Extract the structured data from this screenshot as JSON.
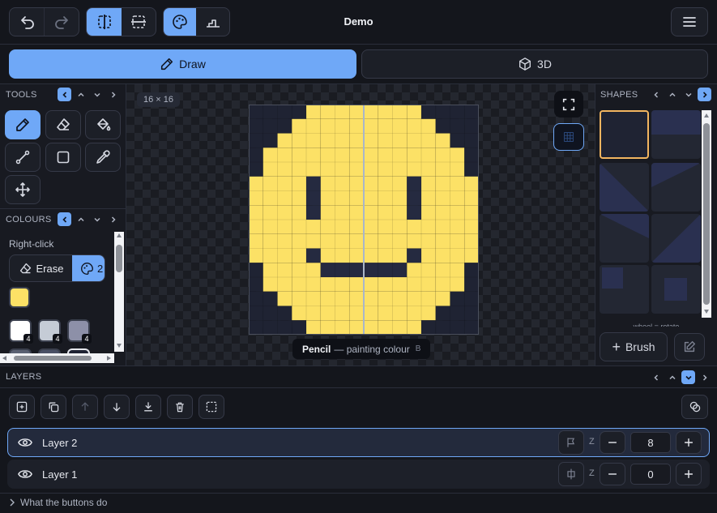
{
  "app": {
    "title": "Demo"
  },
  "modes": {
    "draw_label": "Draw",
    "three_d_label": "3D"
  },
  "tools_panel": {
    "title": "TOOLS"
  },
  "colours_panel": {
    "title": "COLOURS",
    "right_click_label": "Right-click",
    "erase_label": "Erase",
    "right_click_colour_index": "2",
    "selected_colour": "#fce166",
    "swatches": [
      {
        "color": "#ffffff",
        "count": "4"
      },
      {
        "color": "#c5ccd6",
        "count": "4"
      },
      {
        "color": "#8d90a8",
        "count": "4"
      }
    ]
  },
  "canvas": {
    "size_label": "16 × 16",
    "status_tool": "Pencil",
    "status_text": "— painting colour",
    "status_key": "B",
    "face_color": "#fce166",
    "outside_color": "#1f2333",
    "feature_color": "#252a40"
  },
  "shapes_panel": {
    "title": "SHAPES",
    "hint": "wheel = rotate",
    "brush_label": "Brush"
  },
  "layers_panel": {
    "title": "LAYERS",
    "z_label": "Z",
    "layers": [
      {
        "name": "Layer 2",
        "z": "8",
        "selected": true
      },
      {
        "name": "Layer 1",
        "z": "0",
        "selected": false
      }
    ]
  },
  "footer": {
    "help_label": "What the buttons do"
  }
}
